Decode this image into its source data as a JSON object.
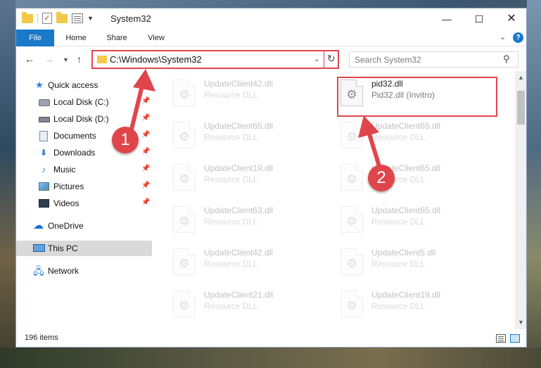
{
  "window": {
    "title": "System32",
    "controls": {
      "minimize": "—",
      "maximize": "☐",
      "close": "✕"
    }
  },
  "ribbon": {
    "tabs": [
      {
        "label": "File"
      },
      {
        "label": "Home"
      },
      {
        "label": "Share"
      },
      {
        "label": "View"
      }
    ],
    "help": "?"
  },
  "address_bar": {
    "path": "C:\\Windows\\System32"
  },
  "search": {
    "placeholder": "Search System32"
  },
  "sidebar": {
    "items": [
      {
        "label": "Quick access",
        "icon": "star-icon"
      },
      {
        "label": "Local Disk (C:)",
        "icon": "drive-icon",
        "pinned": true
      },
      {
        "label": "Local Disk (D:)",
        "icon": "drive-icon",
        "pinned": true
      },
      {
        "label": "Documents",
        "icon": "documents-icon",
        "pinned": true
      },
      {
        "label": "Downloads",
        "icon": "download-icon",
        "pinned": true
      },
      {
        "label": "Music",
        "icon": "music-icon",
        "pinned": true
      },
      {
        "label": "Pictures",
        "icon": "pictures-icon",
        "pinned": true
      },
      {
        "label": "Videos",
        "icon": "videos-icon",
        "pinned": true
      },
      {
        "label": "OneDrive",
        "icon": "onedrive-icon"
      },
      {
        "label": "This PC",
        "icon": "pc-icon",
        "selected": true
      },
      {
        "label": "Network",
        "icon": "network-icon"
      }
    ]
  },
  "files": [
    {
      "name": "UpdateClient42.dll",
      "desc": "Resource DLL",
      "faded": true
    },
    {
      "name": "pid32.dll",
      "desc": "Pid32.dll (Invitro)",
      "faded": false
    },
    {
      "name": "UpdateClient65.dll",
      "desc": "Resource DLL",
      "faded": true
    },
    {
      "name": "UpdateClient65.dll",
      "desc": "Resource DLL",
      "faded": true
    },
    {
      "name": "UpdateClient19.dll",
      "desc": "Resource DLL",
      "faded": true
    },
    {
      "name": "UpdateClient65.dll",
      "desc": "Resource DLL",
      "faded": true
    },
    {
      "name": "UpdateClient63.dll",
      "desc": "Resource DLL",
      "faded": true
    },
    {
      "name": "UpdateClient65.dll",
      "desc": "Resource DLL",
      "faded": true
    },
    {
      "name": "UpdateClient42.dll",
      "desc": "Resource DLL",
      "faded": true
    },
    {
      "name": "UpdateClient5.dll",
      "desc": "Resource DLL",
      "faded": true
    },
    {
      "name": "UpdateClient21.dll",
      "desc": "Resource DLL",
      "faded": true
    },
    {
      "name": "UpdateClient19.dll",
      "desc": "Resource DLL",
      "faded": true
    }
  ],
  "status": {
    "item_count": "196 items"
  },
  "annotations": {
    "badge_1": "1",
    "badge_2": "2",
    "color": "#e0454c"
  },
  "colors": {
    "accent": "#1979ca",
    "annotation_red": "#e0454c"
  }
}
